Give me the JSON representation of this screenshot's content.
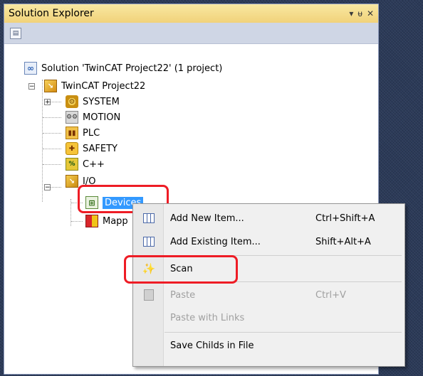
{
  "panel": {
    "title": "Solution Explorer",
    "buttons": {
      "dropdown": "▾",
      "pin": "ᵾ",
      "close": "✕"
    }
  },
  "tree": {
    "solution": "Solution 'TwinCAT Project22' (1 project)",
    "project": "TwinCAT Project22",
    "items": {
      "system": "SYSTEM",
      "motion": "MOTION",
      "plc": "PLC",
      "safety": "SAFETY",
      "cpp": "C++",
      "io": "I/O",
      "devices": "Devices",
      "mappings": "Mapp"
    }
  },
  "context_menu": {
    "add_new_item": {
      "label": "Add New Item...",
      "shortcut": "Ctrl+Shift+A"
    },
    "add_existing_item": {
      "label": "Add Existing Item...",
      "shortcut": "Shift+Alt+A"
    },
    "scan": {
      "label": "Scan"
    },
    "paste": {
      "label": "Paste",
      "shortcut": "Ctrl+V"
    },
    "paste_with_links": {
      "label": "Paste with Links"
    },
    "save_childs": {
      "label": "Save Childs in File"
    }
  },
  "colors": {
    "selection": "#3399ff",
    "highlight": "#ee1c25",
    "titlebar": "#f1d27a"
  }
}
